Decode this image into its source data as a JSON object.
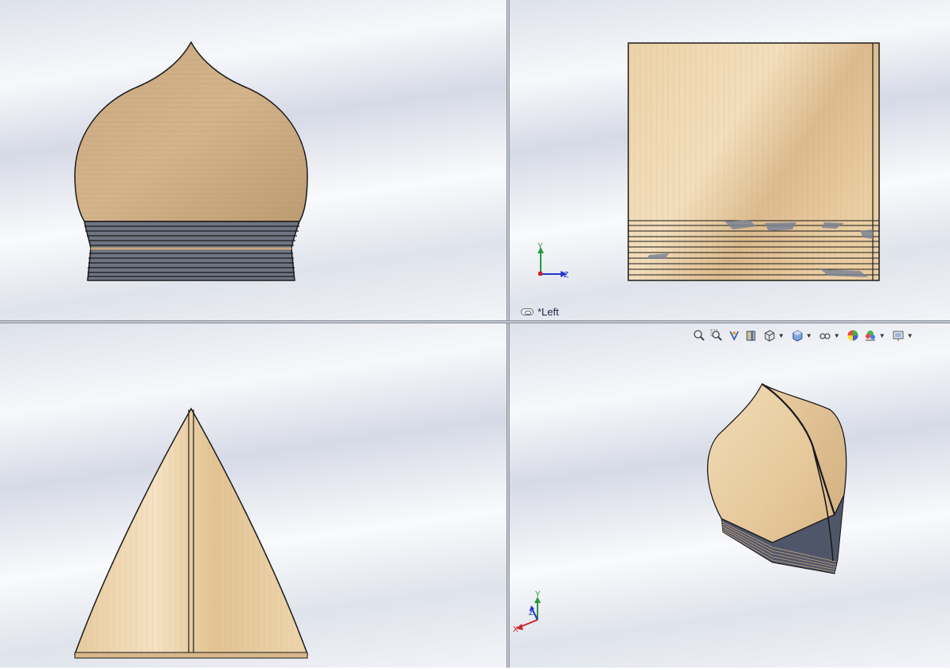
{
  "viewports": {
    "top_right": {
      "view_label": "*Left"
    },
    "axes": {
      "y": "Y",
      "z": "Z",
      "x": "X"
    }
  },
  "heads_up_toolbar": {
    "items": [
      "zoom-to-fit-icon",
      "zoom-to-area-icon",
      "previous-view-icon",
      "section-view-icon",
      "view-orientation-icon",
      "display-style-icon",
      "hide-show-items-icon",
      "edit-appearance-icon",
      "apply-scene-icon",
      "view-settings-icon"
    ]
  },
  "colors": {
    "wood_light": "#e9cfa6",
    "wood_dark": "#c8a57a",
    "edge": "#1a1a1a",
    "stack_gray": "#6e7482",
    "axis_y": "#2a9a3a",
    "axis_z": "#2336c8",
    "axis_x": "#c8252a"
  }
}
